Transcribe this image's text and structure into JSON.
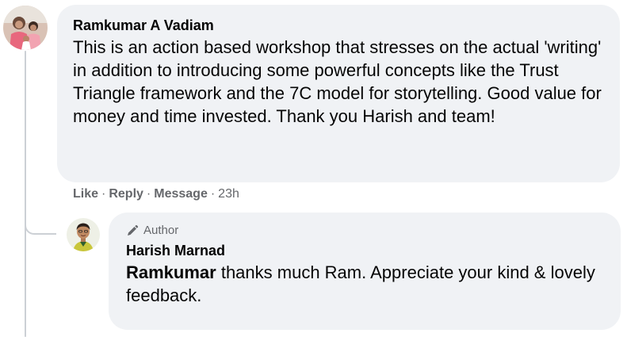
{
  "comment": {
    "author": "Ramkumar A Vadiam",
    "text": "This is an action based workshop that stresses on the actual 'writing' in addition to introducing some powerful concepts like the Trust Triangle framework and the 7C model for storytelling. Good value for money and time invested. Thank you Harish and team!",
    "actions": {
      "like": "Like",
      "reply": "Reply",
      "message": "Message",
      "separator": "·",
      "timestamp": "23h"
    }
  },
  "reply": {
    "badge": "Author",
    "badge_icon": "pen-icon",
    "author": "Harish Marnad",
    "mention": "Ramkumar",
    "text": " thanks much Ram. Appreciate your kind & lovely feedback."
  },
  "colors": {
    "bubble_bg": "#f0f2f5",
    "text": "#050505",
    "secondary_text": "#65676b",
    "thread_line": "#ccd0d5"
  }
}
